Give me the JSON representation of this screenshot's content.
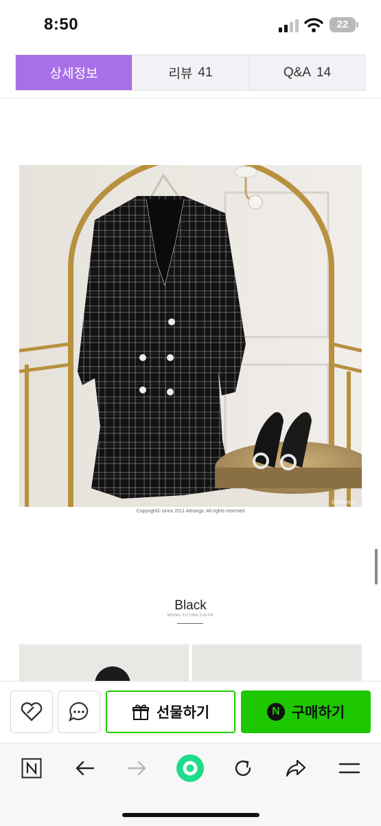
{
  "status_bar": {
    "time": "8:50",
    "battery": "22"
  },
  "tabs": [
    {
      "label": "상세정보",
      "count": ""
    },
    {
      "label": "리뷰",
      "count": "41"
    },
    {
      "label": "Q&A",
      "count": "14"
    }
  ],
  "product": {
    "copyright": "Copyright© since 2011 Attrangs. All rights reserved",
    "watermark": "@Attrangs",
    "color_title": "Black",
    "color_subtitle": "MODEL FITTING COLOR"
  },
  "purchase_bar": {
    "gift_label": "선물하기",
    "buy_label": "구매하기",
    "buy_badge": "N"
  },
  "toolbar": {
    "icons": [
      "naver-n-icon",
      "back-arrow-icon",
      "forward-arrow-icon",
      "home-circle-icon",
      "refresh-icon",
      "share-icon",
      "menu-icon"
    ]
  },
  "colors": {
    "tab_active": "#a870e8",
    "naver_green": "#1ec800"
  }
}
